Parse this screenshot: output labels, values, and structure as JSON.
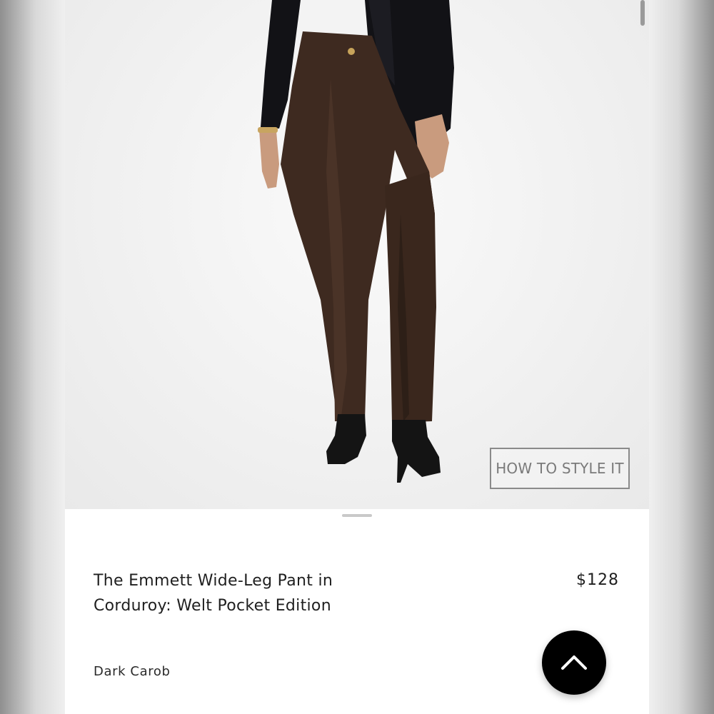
{
  "product": {
    "image_alt": "Model wearing dark brown corduroy wide-leg pants with black blazer and black ankle boots",
    "style_button_label": "HOW TO STYLE IT",
    "title_line1": "The Emmett Wide-Leg Pant in",
    "title_line2": "Corduroy: Welt Pocket Edition",
    "price": "$128",
    "color_name": "Dark Carob"
  },
  "colors": {
    "pant": "#3e2a20",
    "blazer": "#111114",
    "boot": "#141414"
  },
  "icons": {
    "back_to_top": "chevron-up-icon"
  }
}
